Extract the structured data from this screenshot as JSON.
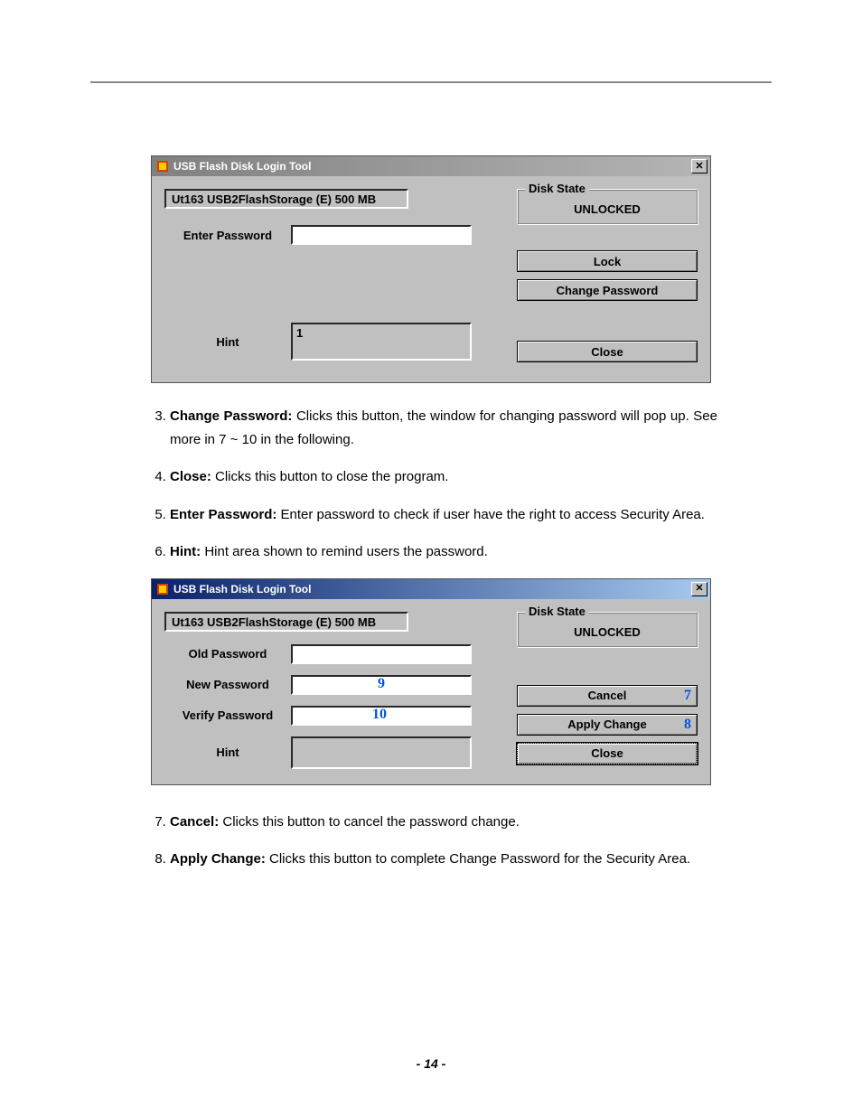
{
  "dialog1": {
    "title": "USB Flash Disk Login Tool",
    "device": "Ut163    USB2FlashStorage (E)  500 MB",
    "disk_state_legend": "Disk State",
    "disk_state_value": "UNLOCKED",
    "labels": {
      "enter_password": "Enter Password",
      "hint": "Hint"
    },
    "hint_value": "1",
    "buttons": {
      "lock": "Lock",
      "change_password": "Change Password",
      "close": "Close"
    }
  },
  "dialog2": {
    "title": "USB Flash Disk Login Tool",
    "device": "Ut163    USB2FlashStorage (E)  500 MB",
    "disk_state_legend": "Disk State",
    "disk_state_value": "UNLOCKED",
    "labels": {
      "old_password": "Old Password",
      "new_password": "New Password",
      "verify_password": "Verify Password",
      "hint": "Hint"
    },
    "annotations": {
      "new": "9",
      "verify": "10",
      "cancel": "7",
      "apply": "8"
    },
    "buttons": {
      "cancel": "Cancel",
      "apply": "Apply Change",
      "close": "Close"
    }
  },
  "list1": {
    "n3_label": "Change Password:",
    "n3_text": " Clicks this button, the window for changing password will pop up. See more in 7 ~ 10 in the following.",
    "n4_label": "Close:",
    "n4_text": " Clicks this button to close the program.",
    "n5_label": "Enter Password:",
    "n5_text": " Enter password to check if user have the right to access Security Area.",
    "n6_label": "Hint:",
    "n6_text": " Hint area shown to remind users the password."
  },
  "list2": {
    "n7_label": "Cancel:",
    "n7_text": " Clicks this button to cancel the password change.",
    "n8_label": "Apply Change:",
    "n8_text": " Clicks this button to complete Change Password for the Security Area."
  },
  "page_number": "- 14 -"
}
